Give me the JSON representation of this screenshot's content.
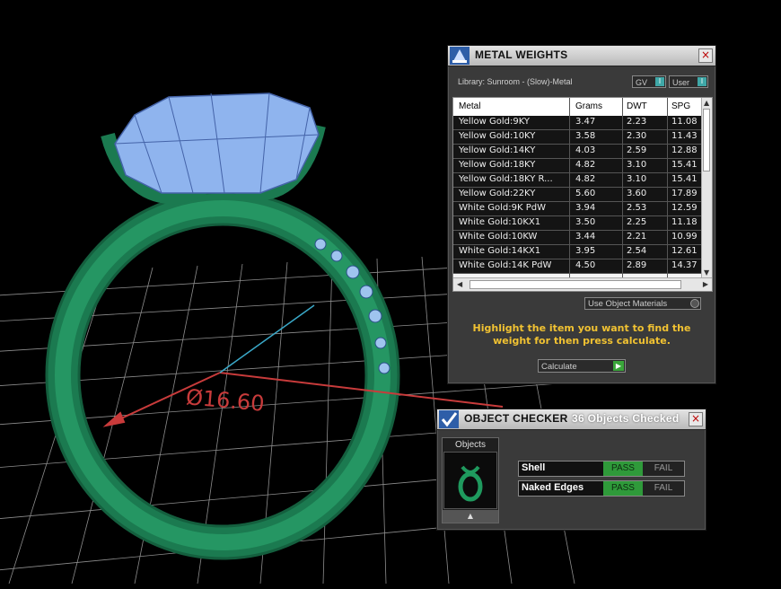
{
  "viewport": {
    "dimension_label": "Ø16.60",
    "colors": {
      "ring": "#1f8a5a",
      "gem": "#8fb4ee",
      "grid": "#cccccc",
      "dimension": "#c83b3b"
    }
  },
  "metal_weights": {
    "title": "METAL WEIGHTS",
    "library": "Library: Sunroom - (Slow)-Metal",
    "toggle_gv": "GV",
    "toggle_user": "User",
    "toggle_knob": "I",
    "columns": [
      "Metal",
      "Grams",
      "DWT",
      "SPG"
    ],
    "rows": [
      [
        "Yellow Gold:9KY",
        "3.47",
        "2.23",
        "11.08"
      ],
      [
        "Yellow Gold:10KY",
        "3.58",
        "2.30",
        "11.43"
      ],
      [
        "Yellow Gold:14KY",
        "4.03",
        "2.59",
        "12.88"
      ],
      [
        "Yellow Gold:18KY",
        "4.82",
        "3.10",
        "15.41"
      ],
      [
        "Yellow Gold:18KY R...",
        "4.82",
        "3.10",
        "15.41"
      ],
      [
        "Yellow Gold:22KY",
        "5.60",
        "3.60",
        "17.89"
      ],
      [
        "White Gold:9K PdW",
        "3.94",
        "2.53",
        "12.59"
      ],
      [
        "White Gold:10KX1",
        "3.50",
        "2.25",
        "11.18"
      ],
      [
        "White Gold:10KW",
        "3.44",
        "2.21",
        "10.99"
      ],
      [
        "White Gold:14KX1",
        "3.95",
        "2.54",
        "12.61"
      ],
      [
        "White Gold:14K PdW",
        "4.50",
        "2.89",
        "14.37"
      ]
    ],
    "use_object_materials": "Use Object Materials",
    "hint": "Highlight the item you want to find the weight for then press calculate.",
    "calculate": "Calculate"
  },
  "object_checker": {
    "title": "OBJECT CHECKER",
    "status": "36 Objects Checked",
    "objects_label": "Objects",
    "checks": [
      {
        "name": "Shell",
        "pass": "PASS",
        "fail": "FAIL"
      },
      {
        "name": "Naked Edges",
        "pass": "PASS",
        "fail": "FAIL"
      }
    ]
  }
}
